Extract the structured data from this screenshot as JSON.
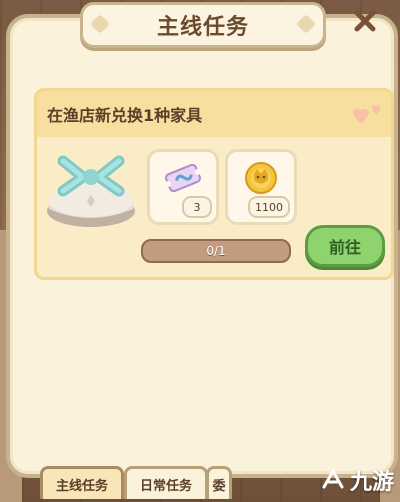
{
  "window": {
    "title": "主线任务"
  },
  "task": {
    "description": "在渔店新兑换1种家具",
    "progress_text": "0/1",
    "progress_value": 0,
    "go_label": "前往",
    "rewards": [
      {
        "icon": "ticket-icon",
        "count": "3"
      },
      {
        "icon": "gold-coin-icon",
        "count": "1100"
      }
    ],
    "item_icon": "furniture-pedestal-icon"
  },
  "tabs": [
    {
      "label": "主线任务",
      "active": true
    },
    {
      "label": "日常任务",
      "active": false
    },
    {
      "label": "委",
      "active": false
    }
  ],
  "watermark": {
    "text": "九游"
  },
  "colors": {
    "accent_green": "#8fd36e",
    "panel": "#fbf2dc",
    "header": "#f7df9f"
  }
}
